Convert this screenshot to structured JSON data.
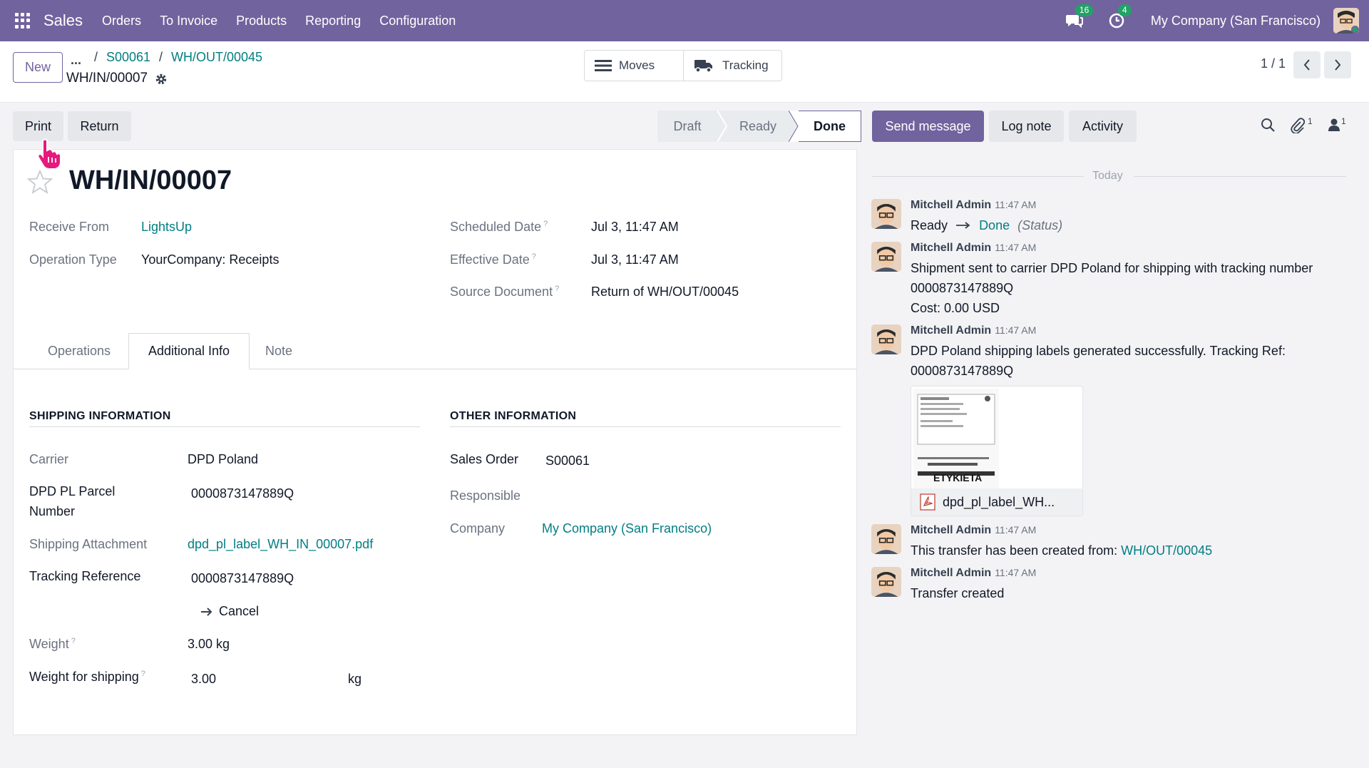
{
  "topbar": {
    "brand": "Sales",
    "menu": [
      "Orders",
      "To Invoice",
      "Products",
      "Reporting",
      "Configuration"
    ],
    "messages_count": "16",
    "activities_count": "4",
    "company": "My Company (San Francisco)"
  },
  "control": {
    "new_label": "New",
    "breadcrumb_dots": "...",
    "breadcrumb_sep": "/",
    "breadcrumb": [
      "S00061",
      "WH/OUT/00045"
    ],
    "record_name": "WH/IN/00007",
    "smart_buttons": {
      "moves": "Moves",
      "tracking": "Tracking"
    },
    "pager": "1 / 1"
  },
  "actions": {
    "print": "Print",
    "return": "Return"
  },
  "status": {
    "draft": "Draft",
    "ready": "Ready",
    "done": "Done"
  },
  "form": {
    "title": "WH/IN/00007",
    "help_mark": "?",
    "receive_from_label": "Receive From",
    "receive_from": "LightsUp",
    "operation_type_label": "Operation Type",
    "operation_type": "YourCompany: Receipts",
    "scheduled_date_label": "Scheduled Date",
    "scheduled_date": "Jul 3, 11:47 AM",
    "effective_date_label": "Effective Date",
    "effective_date": "Jul 3, 11:47 AM",
    "source_document_label": "Source Document",
    "source_document": "Return of WH/OUT/00045",
    "tabs": [
      "Operations",
      "Additional Info",
      "Note"
    ],
    "shipping": {
      "title": "SHIPPING INFORMATION",
      "carrier_label": "Carrier",
      "carrier": "DPD Poland",
      "parcel_label_1": "DPD PL Parcel",
      "parcel_label_2": "Number",
      "parcel_number": "0000873147889Q",
      "attachment_label": "Shipping Attachment",
      "attachment": "dpd_pl_label_WH_IN_00007.pdf",
      "tracking_label": "Tracking Reference",
      "tracking": "0000873147889Q",
      "cancel": "Cancel",
      "weight_label": "Weight",
      "weight": "3.00 kg",
      "weight_shipping_label": "Weight for shipping",
      "weight_shipping": "3.00",
      "weight_unit": "kg"
    },
    "other": {
      "title": "OTHER INFORMATION",
      "sales_order_label": "Sales Order",
      "sales_order": "S00061",
      "responsible_label": "Responsible",
      "company_label": "Company",
      "company": "My Company (San Francisco)"
    }
  },
  "chatter": {
    "send_message": "Send message",
    "log_note": "Log note",
    "activity": "Activity",
    "attachments_count": "1",
    "followers_count": "1",
    "today": "Today",
    "messages": [
      {
        "author": "Mitchell Admin",
        "time": "11:47 AM",
        "from": "Ready",
        "to": "Done",
        "field": "(Status)"
      },
      {
        "author": "Mitchell Admin",
        "time": "11:47 AM",
        "line1": "Shipment sent to carrier DPD Poland for shipping with tracking number",
        "line2": "0000873147889Q",
        "line3": "Cost: 0.00 USD"
      },
      {
        "author": "Mitchell Admin",
        "time": "11:47 AM",
        "line1": "DPD Poland shipping labels generated successfully. Tracking Ref:",
        "line2": "0000873147889Q",
        "attachment": "dpd_pl_label_WH...",
        "thumb_text": "ETYKIETA"
      },
      {
        "author": "Mitchell Admin",
        "time": "11:47 AM",
        "text": "This transfer has been created from:",
        "link": "WH/OUT/00045"
      },
      {
        "author": "Mitchell Admin",
        "time": "11:47 AM",
        "text": "Transfer created"
      }
    ]
  },
  "colors": {
    "brand": "#71639e",
    "link": "#017e84",
    "badge": "#21a366",
    "cursor": "#e6197d"
  }
}
